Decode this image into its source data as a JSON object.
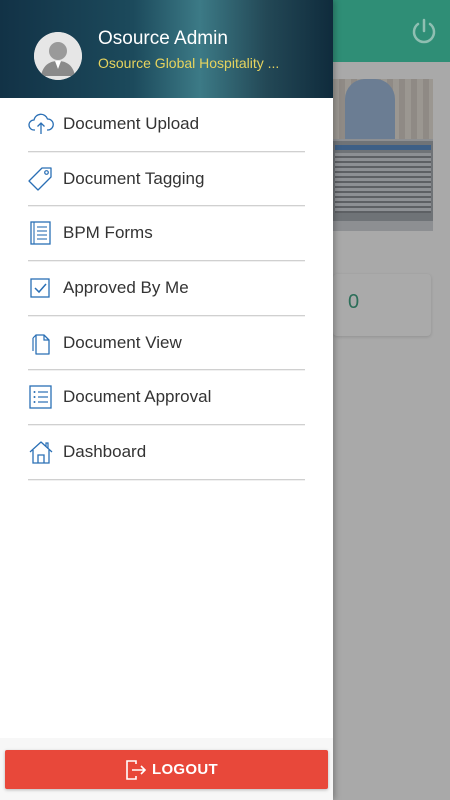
{
  "user": {
    "name": "Osource Admin",
    "organization": "Osource Global Hospitality ..."
  },
  "menu": {
    "items": [
      {
        "label": "Document Upload",
        "icon": "cloud-upload-icon"
      },
      {
        "label": "Document Tagging",
        "icon": "tag-icon"
      },
      {
        "label": "BPM Forms",
        "icon": "form-icon"
      },
      {
        "label": "Approved By Me",
        "icon": "checkbox-icon"
      },
      {
        "label": "Document View",
        "icon": "document-icon"
      },
      {
        "label": "Document Approval",
        "icon": "list-icon"
      },
      {
        "label": "Dashboard",
        "icon": "home-icon"
      }
    ]
  },
  "logout": {
    "label": "LOGOUT",
    "icon": "logout-icon"
  },
  "background": {
    "card_count": "0",
    "power_icon": "power-icon"
  },
  "colors": {
    "header_green": "#2f8e76",
    "icon_blue": "#2a6fb5",
    "logout_red": "#e8483a",
    "org_yellow": "#e6d35e"
  }
}
